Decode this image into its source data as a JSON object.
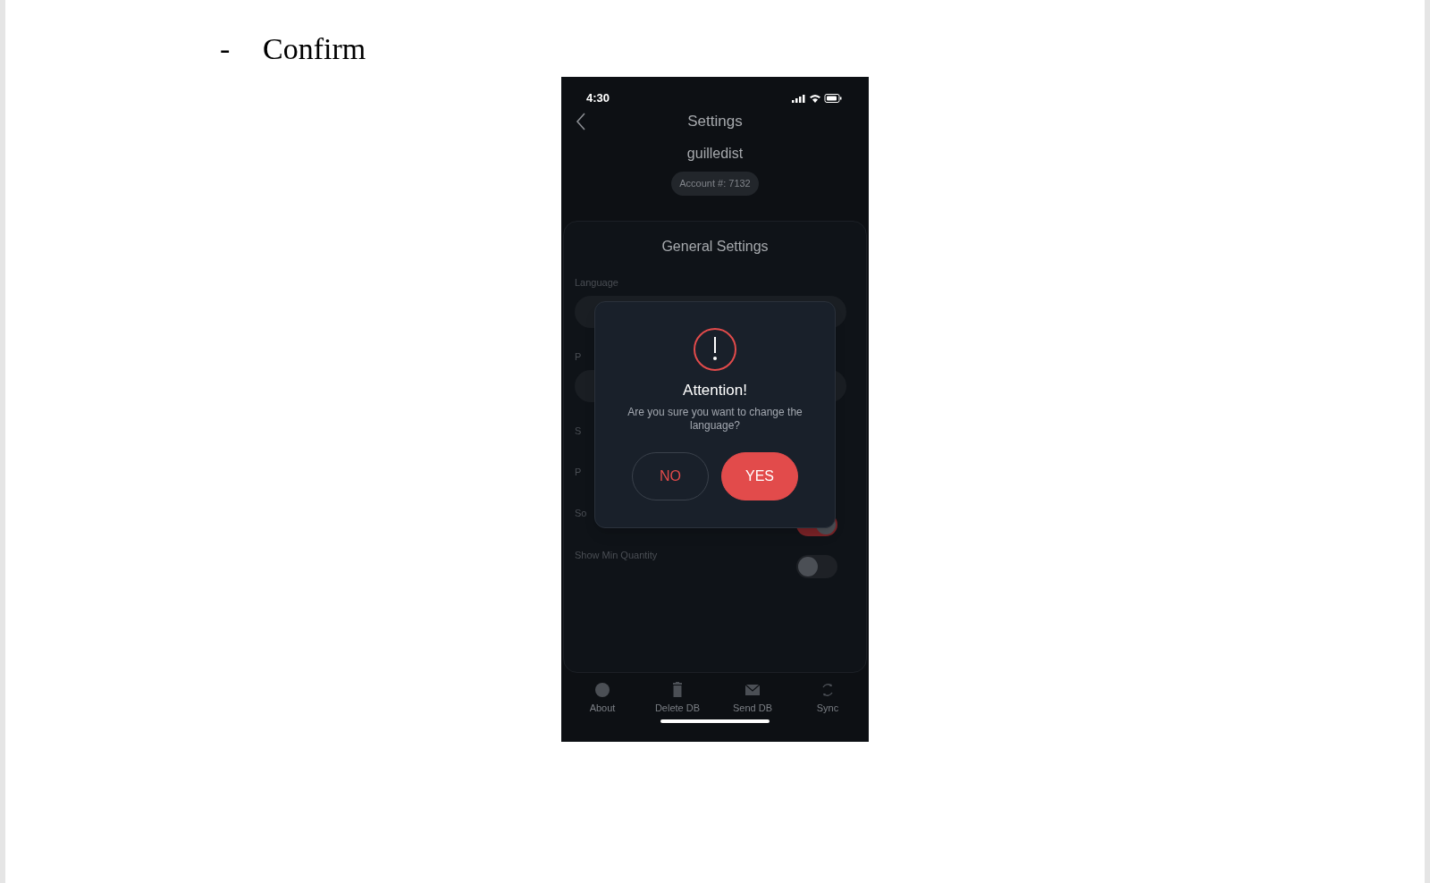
{
  "document": {
    "bullet": "-",
    "heading": "Confirm"
  },
  "phone": {
    "status_bar": {
      "time": "4:30"
    },
    "header": {
      "title": "Settings",
      "username": "guilledist",
      "account": "Account #: 7132"
    },
    "card": {
      "title": "General Settings",
      "items": [
        {
          "kind": "field",
          "label": "Language"
        },
        {
          "kind": "field",
          "label": "P"
        },
        {
          "kind": "label",
          "label": "S"
        },
        {
          "kind": "label",
          "label": "P"
        },
        {
          "kind": "toggle",
          "label": "So",
          "on": true
        },
        {
          "kind": "toggle",
          "label": "Show Min Quantity",
          "on": false
        }
      ]
    },
    "dialog": {
      "title": "Attention!",
      "message": "Are you sure you want to change the language?",
      "buttons": [
        {
          "label": "NO",
          "kind": "secondary"
        },
        {
          "label": "YES",
          "kind": "primary"
        }
      ]
    },
    "tab_bar": [
      {
        "label": "About",
        "kind": "about"
      },
      {
        "label": "Delete DB",
        "kind": "delete"
      },
      {
        "label": "Send DB",
        "kind": "send"
      },
      {
        "label": "Sync",
        "kind": "sync"
      }
    ]
  }
}
